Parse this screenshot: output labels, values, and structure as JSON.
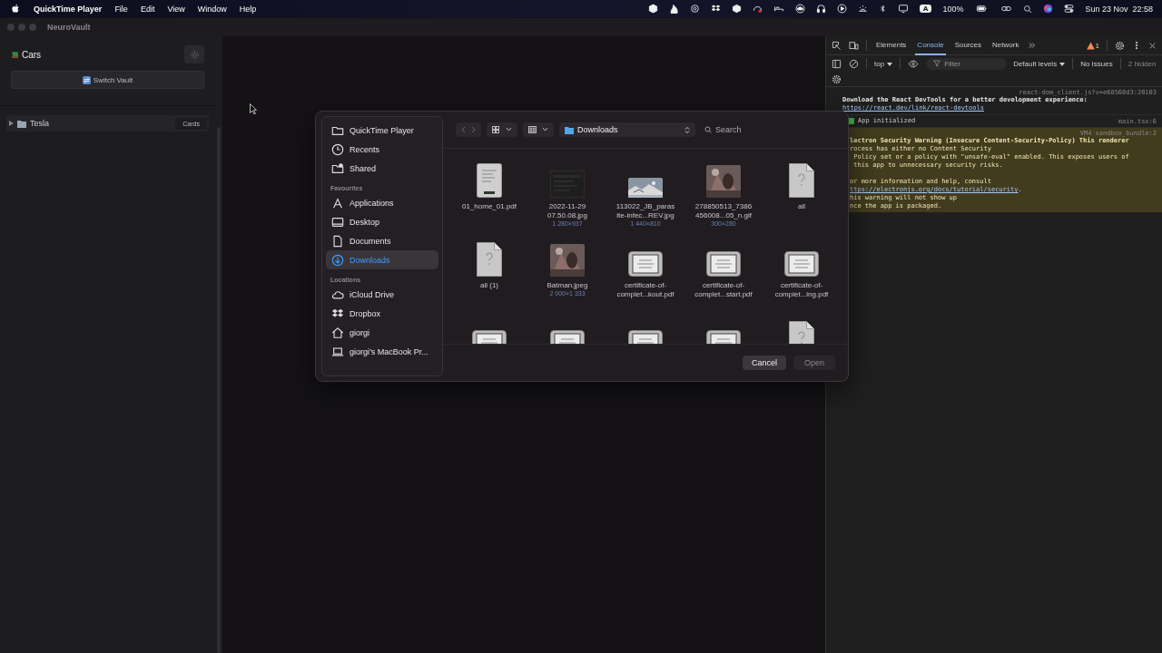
{
  "menu_bar": {
    "app": "QuickTime Player",
    "menus": [
      "File",
      "Edit",
      "View",
      "Window",
      "Help"
    ],
    "keyboard": "A",
    "battery": "100%",
    "datetime": "Sun 23 Nov  22:58"
  },
  "window": {
    "title": "NeuroVault"
  },
  "sidebar": {
    "vault": "Cars",
    "switch_button": "Switch Vault",
    "items": [
      {
        "label": "Tesla",
        "expanded": false,
        "badge": "Cards"
      }
    ]
  },
  "devtools": {
    "tabs": [
      {
        "label": "Elements",
        "selected": false
      },
      {
        "label": "Console",
        "selected": true
      },
      {
        "label": "Sources",
        "selected": false
      },
      {
        "label": "Network",
        "selected": false
      }
    ],
    "warning_count": "1",
    "context": "top",
    "filter": {
      "placeholder": "Filter"
    },
    "levels": "Default levels",
    "issues": "No Issues",
    "hidden": "2 hidden",
    "messages": [
      {
        "kind": "info",
        "source": "react-dom_client.js?v=e68560d3:20103",
        "lines": [
          "Download the React DevTools for a better development experience:"
        ],
        "link": "https://react.dev/link/react-devtools"
      },
      {
        "kind": "log",
        "source": "main.tsx:6",
        "lines": [
          "App initialized"
        ]
      },
      {
        "kind": "warning",
        "source": "VM4 sandbox_bundle:2",
        "lines": [
          "lectron Security Warning (Insecure Content-Security-Policy) This renderer",
          "rocess has either no Content Security",
          " Policy set or a policy with \"unsafe-eval\" enabled. This exposes users of",
          " this app to unnecessary security risks."
        ],
        "lines_after_gap": [
          "or more information and help, consult"
        ],
        "link": "ttps://electronjs.org/docs/tutorial/security",
        "link_suffix": ".",
        "tail": [
          "his warning will not show up",
          "nce the app is packaged."
        ]
      }
    ]
  },
  "dialog": {
    "sidebar": [
      {
        "items": [
          {
            "label": "QuickTime Player",
            "selected": false
          },
          {
            "label": "Recents",
            "selected": false
          },
          {
            "label": "Shared",
            "selected": false
          }
        ]
      },
      {
        "header": "Favourites",
        "items": [
          {
            "label": "Applications",
            "selected": false
          },
          {
            "label": "Desktop",
            "selected": false
          },
          {
            "label": "Documents",
            "selected": false
          },
          {
            "label": "Downloads",
            "selected": true
          }
        ]
      },
      {
        "header": "Locations",
        "items": [
          {
            "label": "iCloud Drive",
            "selected": false
          },
          {
            "label": "Dropbox",
            "selected": false
          },
          {
            "label": "giorgi",
            "selected": false
          },
          {
            "label": "giorgi’s MacBook Pr...",
            "selected": false
          }
        ]
      }
    ],
    "location": "Downloads",
    "search": {
      "placeholder": "Search"
    },
    "files": [
      {
        "kind": "pdf",
        "lines": [
          "01_home_01.pdf"
        ]
      },
      {
        "kind": "dark-image",
        "lines": [
          "2022-11-29",
          "07.50.08.jpg"
        ],
        "dims": "1 280×937"
      },
      {
        "lines": [
          "113022_JB_paras",
          "ite-infec...REV.jpg"
        ],
        "dims": "1 440×810"
      },
      {
        "lines": [
          "278850513_7386",
          "456008...05_n.gif"
        ],
        "dims": "300×280"
      },
      {
        "kind": "unknown",
        "lines": [
          "all"
        ]
      },
      {
        "kind": "unknown",
        "lines": [
          "all (1)"
        ]
      },
      {
        "lines": [
          "Batman.jpeg"
        ],
        "dims": "2 000×1 333"
      },
      {
        "kind": "certificate",
        "lines": [
          "certificate-of-",
          "complet...kout.pdf"
        ]
      },
      {
        "kind": "certificate",
        "lines": [
          "certificate-of-",
          "complet...start.pdf"
        ]
      },
      {
        "kind": "certificate",
        "lines": [
          "certificate-of-",
          "complet...ing.pdf"
        ]
      },
      {
        "kind": "certificate"
      },
      {
        "kind": "certificate"
      },
      {
        "kind": "certificate"
      },
      {
        "kind": "certificate"
      },
      {
        "kind": "unknown"
      }
    ],
    "buttons": [
      {
        "label": "Cancel",
        "disabled": false
      },
      {
        "label": "Open",
        "disabled": true
      }
    ]
  }
}
